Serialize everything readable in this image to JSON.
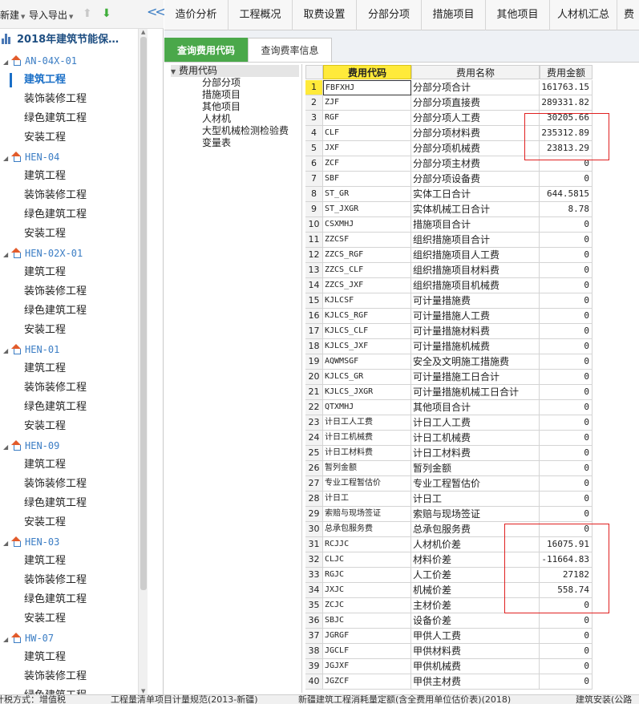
{
  "toolbar": {
    "new_label": "新建",
    "import_export_label": "导入导出"
  },
  "project_title": "2018年建筑节能保…",
  "units": [
    {
      "name": "AN-04X-01",
      "children": [
        "建筑工程",
        "装饰装修工程",
        "绿色建筑工程",
        "安装工程"
      ]
    },
    {
      "name": "HEN-04",
      "children": [
        "建筑工程",
        "装饰装修工程",
        "绿色建筑工程",
        "安装工程"
      ]
    },
    {
      "name": "HEN-02X-01",
      "children": [
        "建筑工程",
        "装饰装修工程",
        "绿色建筑工程",
        "安装工程"
      ]
    },
    {
      "name": "HEN-01",
      "children": [
        "建筑工程",
        "装饰装修工程",
        "绿色建筑工程",
        "安装工程"
      ]
    },
    {
      "name": "HEN-09",
      "children": [
        "建筑工程",
        "装饰装修工程",
        "绿色建筑工程",
        "安装工程"
      ]
    },
    {
      "name": "HEN-03",
      "children": [
        "建筑工程",
        "装饰装修工程",
        "绿色建筑工程",
        "安装工程"
      ]
    },
    {
      "name": "HW-07",
      "children": [
        "建筑工程",
        "装饰装修工程",
        "绿色建筑工程"
      ]
    }
  ],
  "top_tabs": [
    "造价分析",
    "工程概况",
    "取费设置",
    "分部分项",
    "措施项目",
    "其他项目",
    "人材机汇总",
    "费"
  ],
  "sub_tabs": [
    "查询费用代码",
    "查询费率信息"
  ],
  "categories": {
    "root": "费用代码",
    "items": [
      "分部分项",
      "措施项目",
      "其他项目",
      "人材机",
      "大型机械检测检验费",
      "变量表"
    ]
  },
  "grid": {
    "headers": {
      "code": "费用代码",
      "name": "费用名称",
      "amount": "费用金额"
    },
    "rows": [
      {
        "n": "1",
        "code": "FBFXHJ",
        "name": "分部分项合计",
        "amount": "161763.15"
      },
      {
        "n": "2",
        "code": "ZJF",
        "name": "分部分项直接费",
        "amount": "289331.82"
      },
      {
        "n": "3",
        "code": "RGF",
        "name": "分部分项人工费",
        "amount": "30205.66"
      },
      {
        "n": "4",
        "code": "CLF",
        "name": "分部分项材料费",
        "amount": "235312.89"
      },
      {
        "n": "5",
        "code": "JXF",
        "name": "分部分项机械费",
        "amount": "23813.29"
      },
      {
        "n": "6",
        "code": "ZCF",
        "name": "分部分项主材费",
        "amount": "0"
      },
      {
        "n": "7",
        "code": "SBF",
        "name": "分部分项设备费",
        "amount": "0"
      },
      {
        "n": "8",
        "code": "ST_GR",
        "name": "实体工日合计",
        "amount": "644.5815"
      },
      {
        "n": "9",
        "code": "ST_JXGR",
        "name": "实体机械工日合计",
        "amount": "8.78"
      },
      {
        "n": "10",
        "code": "CSXMHJ",
        "name": "措施项目合计",
        "amount": "0"
      },
      {
        "n": "11",
        "code": "ZZCSF",
        "name": "组织措施项目合计",
        "amount": "0"
      },
      {
        "n": "12",
        "code": "ZZCS_RGF",
        "name": "组织措施项目人工费",
        "amount": "0"
      },
      {
        "n": "13",
        "code": "ZZCS_CLF",
        "name": "组织措施项目材料费",
        "amount": "0"
      },
      {
        "n": "14",
        "code": "ZZCS_JXF",
        "name": "组织措施项目机械费",
        "amount": "0"
      },
      {
        "n": "15",
        "code": "KJLCSF",
        "name": "可计量措施费",
        "amount": "0"
      },
      {
        "n": "16",
        "code": "KJLCS_RGF",
        "name": "可计量措施人工费",
        "amount": "0"
      },
      {
        "n": "17",
        "code": "KJLCS_CLF",
        "name": "可计量措施材料费",
        "amount": "0"
      },
      {
        "n": "18",
        "code": "KJLCS_JXF",
        "name": "可计量措施机械费",
        "amount": "0"
      },
      {
        "n": "19",
        "code": "AQWMSGF",
        "name": "安全及文明施工措施费",
        "amount": "0"
      },
      {
        "n": "20",
        "code": "KJLCS_GR",
        "name": "可计量措施工日合计",
        "amount": "0"
      },
      {
        "n": "21",
        "code": "KJLCS_JXGR",
        "name": "可计量措施机械工日合计",
        "amount": "0"
      },
      {
        "n": "22",
        "code": "QTXMHJ",
        "name": "其他项目合计",
        "amount": "0"
      },
      {
        "n": "23",
        "code": "计日工人工费",
        "name": "计日工人工费",
        "amount": "0"
      },
      {
        "n": "24",
        "code": "计日工机械费",
        "name": "计日工机械费",
        "amount": "0"
      },
      {
        "n": "25",
        "code": "计日工材料费",
        "name": "计日工材料费",
        "amount": "0"
      },
      {
        "n": "26",
        "code": "暂列金额",
        "name": "暂列金额",
        "amount": "0"
      },
      {
        "n": "27",
        "code": "专业工程暂估价",
        "name": "专业工程暂估价",
        "amount": "0"
      },
      {
        "n": "28",
        "code": "计日工",
        "name": "计日工",
        "amount": "0"
      },
      {
        "n": "29",
        "code": "索赔与现场签证",
        "name": "索赔与现场签证",
        "amount": "0"
      },
      {
        "n": "30",
        "code": "总承包服务费",
        "name": "总承包服务费",
        "amount": "0"
      },
      {
        "n": "31",
        "code": "RCJJC",
        "name": "人材机价差",
        "amount": "16075.91"
      },
      {
        "n": "32",
        "code": "CLJC",
        "name": "材料价差",
        "amount": "-11664.83"
      },
      {
        "n": "33",
        "code": "RGJC",
        "name": "人工价差",
        "amount": "27182"
      },
      {
        "n": "34",
        "code": "JXJC",
        "name": "机械价差",
        "amount": "558.74"
      },
      {
        "n": "35",
        "code": "ZCJC",
        "name": "主材价差",
        "amount": "0"
      },
      {
        "n": "36",
        "code": "SBJC",
        "name": "设备价差",
        "amount": "0"
      },
      {
        "n": "37",
        "code": "JGRGF",
        "name": "甲供人工费",
        "amount": "0"
      },
      {
        "n": "38",
        "code": "JGCLF",
        "name": "甲供材料费",
        "amount": "0"
      },
      {
        "n": "39",
        "code": "JGJXF",
        "name": "甲供机械费",
        "amount": "0"
      },
      {
        "n": "40",
        "code": "JGZCF",
        "name": "甲供主材费",
        "amount": "0"
      }
    ]
  },
  "status_bar": [
    "计税方式：增值税",
    "工程量清单项目计量规范(2013-新疆)",
    "新疆建筑工程消耗量定额(含全费用单位估价表)(2018)",
    "建筑安装(公路"
  ],
  "colors": {
    "accent_green": "#4aa84a",
    "header_yellow": "#ffea3a",
    "highlight_red": "#e02020",
    "link_blue": "#3b7dc4"
  }
}
